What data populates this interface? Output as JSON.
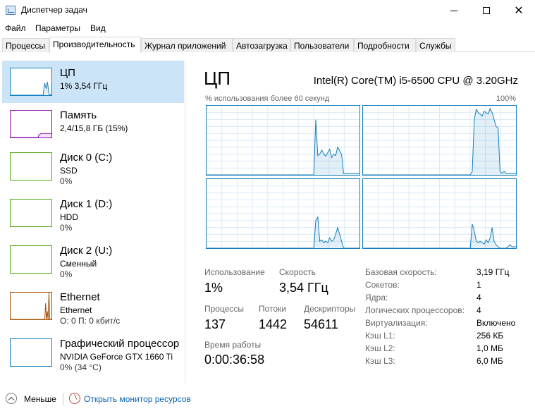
{
  "window": {
    "title": "Диспетчер задач"
  },
  "menu": [
    "Файл",
    "Параметры",
    "Вид"
  ],
  "tabs": [
    "Процессы",
    "Производительность",
    "Журнал приложений",
    "Автозагрузка",
    "Пользователи",
    "Подробности",
    "Службы"
  ],
  "active_tab": "Производительность",
  "sidebar": [
    {
      "name": "ЦП",
      "line2": "1% 3,54 ГГц",
      "line3": "",
      "color": "#117dbb",
      "selected": true,
      "levels": [
        0,
        0,
        0,
        0,
        0,
        0,
        0,
        0,
        0,
        0,
        0,
        0,
        0,
        0,
        0,
        0,
        0,
        0,
        0,
        0,
        0,
        0,
        0,
        0,
        0,
        0,
        0,
        0,
        0,
        0,
        0,
        0,
        0,
        0,
        0,
        0,
        0,
        0,
        0,
        0,
        0.25,
        0.45,
        0.3,
        0.25,
        0.5,
        0.3,
        0.05,
        0.02,
        0.02,
        0.02
      ]
    },
    {
      "name": "Память",
      "line2": "2,4/15,8 ГБ (15%)",
      "line3": "",
      "color": "#8b12ae",
      "selected": false,
      "levels": [
        0,
        0,
        0,
        0,
        0,
        0,
        0,
        0,
        0,
        0,
        0,
        0,
        0,
        0,
        0,
        0,
        0,
        0,
        0,
        0,
        0,
        0,
        0,
        0,
        0,
        0,
        0,
        0,
        0,
        0,
        0,
        0,
        0,
        0,
        0.1,
        0.12,
        0.14,
        0.15,
        0.15,
        0.15,
        0.15,
        0.15,
        0.15,
        0.15,
        0.15,
        0.15,
        0.15,
        0.15,
        0.15,
        0.15
      ]
    },
    {
      "name": "Диск 0 (C:)",
      "line2": "SSD",
      "line3": "0%",
      "color": "#4da60c",
      "selected": false,
      "levels": []
    },
    {
      "name": "Диск 1 (D:)",
      "line2": "HDD",
      "line3": "0%",
      "color": "#4da60c",
      "selected": false,
      "levels": []
    },
    {
      "name": "Диск 2 (U:)",
      "line2": "Сменный",
      "line3": "0%",
      "color": "#4da60c",
      "selected": false,
      "levels": []
    },
    {
      "name": "Ethernet",
      "line2": "Ethernet",
      "line3": "О: 0 П: 0 кбит/с",
      "color": "#a74f01",
      "selected": false,
      "levels": [
        0,
        0,
        0,
        0,
        0,
        0,
        0,
        0,
        0,
        0,
        0,
        0,
        0,
        0,
        0,
        0,
        0,
        0,
        0,
        0,
        0,
        0,
        0,
        0,
        0,
        0,
        0,
        0,
        0,
        0,
        0,
        0,
        0,
        0,
        0,
        0,
        0,
        0,
        0,
        0,
        0,
        0,
        0.6,
        0,
        0.3,
        0,
        1,
        0,
        0,
        0
      ]
    },
    {
      "name": "Графический процессор",
      "line2": "NVIDIA GeForce GTX 1660 Ti",
      "line3": "0% (34 °C)",
      "color": "#117dbb",
      "selected": false,
      "levels": []
    }
  ],
  "main": {
    "title": "ЦП",
    "cpu_model": "Intel(R) Core(TM) i5-6500 CPU @ 3.20GHz",
    "graph_caption": "% использования более 60 секунд",
    "graph_max": "100%",
    "cores": [
      [
        0,
        0,
        0,
        0,
        0,
        0,
        0,
        0,
        0,
        0,
        0,
        0,
        0,
        0,
        0,
        0,
        0,
        0,
        0,
        0,
        0,
        0,
        0,
        0,
        0,
        0,
        0,
        0,
        0,
        0,
        0,
        0,
        0,
        0,
        0,
        0,
        0,
        0,
        0,
        0,
        0,
        0,
        0,
        0,
        0,
        0,
        0,
        0,
        0,
        0,
        0,
        0,
        0,
        0,
        0,
        0.8,
        0.28,
        0.3,
        0.36,
        0.3,
        0.27,
        0.32,
        0.37,
        0.25,
        0.3,
        0.28,
        0.4,
        0.35,
        0.3,
        0.02,
        0.02,
        0.02,
        0.02,
        0.02,
        0.02,
        0.02,
        0.02,
        0.02
      ],
      [
        0,
        0,
        0,
        0,
        0,
        0,
        0,
        0,
        0,
        0,
        0,
        0,
        0,
        0,
        0,
        0,
        0,
        0,
        0,
        0,
        0,
        0,
        0,
        0,
        0,
        0,
        0,
        0,
        0,
        0,
        0,
        0,
        0,
        0,
        0,
        0,
        0,
        0,
        0,
        0,
        0,
        0,
        0,
        0,
        0,
        0,
        0,
        0,
        0,
        0,
        0,
        0,
        0,
        0,
        0,
        0.05,
        0.8,
        0.95,
        0.9,
        0.88,
        0.85,
        0.92,
        0.9,
        0.88,
        0.96,
        0.9,
        0.8,
        0.7,
        0.68,
        0.05,
        0.02,
        0.05,
        0.02,
        0.02,
        0.02,
        0.02,
        0.02,
        0.02
      ],
      [
        0,
        0,
        0,
        0,
        0,
        0,
        0,
        0,
        0,
        0,
        0,
        0,
        0,
        0,
        0,
        0,
        0,
        0,
        0,
        0,
        0,
        0,
        0,
        0,
        0,
        0,
        0,
        0,
        0,
        0,
        0,
        0,
        0,
        0,
        0,
        0,
        0,
        0,
        0,
        0,
        0,
        0,
        0,
        0,
        0,
        0,
        0,
        0,
        0,
        0,
        0,
        0,
        0,
        0,
        0,
        0.4,
        0.45,
        0.1,
        0.12,
        0.08,
        0.1,
        0.08,
        0.15,
        0.1,
        0.12,
        0.2,
        0.3,
        0.2,
        0.1,
        0,
        0,
        0,
        0,
        0,
        0,
        0,
        0,
        0
      ],
      [
        0,
        0,
        0,
        0,
        0,
        0,
        0,
        0,
        0,
        0,
        0,
        0,
        0,
        0,
        0,
        0,
        0,
        0,
        0,
        0,
        0,
        0,
        0,
        0,
        0,
        0,
        0,
        0,
        0,
        0,
        0,
        0,
        0,
        0,
        0,
        0,
        0,
        0,
        0,
        0,
        0,
        0,
        0,
        0,
        0,
        0,
        0,
        0,
        0,
        0,
        0,
        0,
        0,
        0,
        0,
        0.35,
        0.25,
        0.1,
        0.08,
        0.1,
        0.08,
        0.06,
        0.12,
        0.08,
        0.15,
        0.3,
        0.1,
        0.05,
        0.02,
        0,
        0,
        0,
        0,
        0.02,
        0.05,
        0.02,
        0.02,
        0.02
      ]
    ],
    "stats": {
      "usage_label": "Использование",
      "usage": "1%",
      "speed_label": "Скорость",
      "speed": "3,54 ГГц",
      "proc_label": "Процессы",
      "proc": "137",
      "threads_label": "Потоки",
      "threads": "1442",
      "handles_label": "Дескрипторы",
      "handles": "54611",
      "uptime_label": "Время работы",
      "uptime": "0:00:36:58"
    },
    "info": [
      {
        "label": "Базовая скорость:",
        "value": "3,19 ГГц"
      },
      {
        "label": "Сокетов:",
        "value": "1"
      },
      {
        "label": "Ядра:",
        "value": "4"
      },
      {
        "label": "Логических процессоров:",
        "value": "4"
      },
      {
        "label": "Виртуализация:",
        "value": "Включено"
      },
      {
        "label": "Кэш L1:",
        "value": "256 КБ"
      },
      {
        "label": "Кэш L2:",
        "value": "1,0 МБ"
      },
      {
        "label": "Кэш L3:",
        "value": "6,0 МБ"
      }
    ]
  },
  "footer": {
    "less": "Меньше",
    "monitor_link": "Открыть монитор ресурсов"
  }
}
